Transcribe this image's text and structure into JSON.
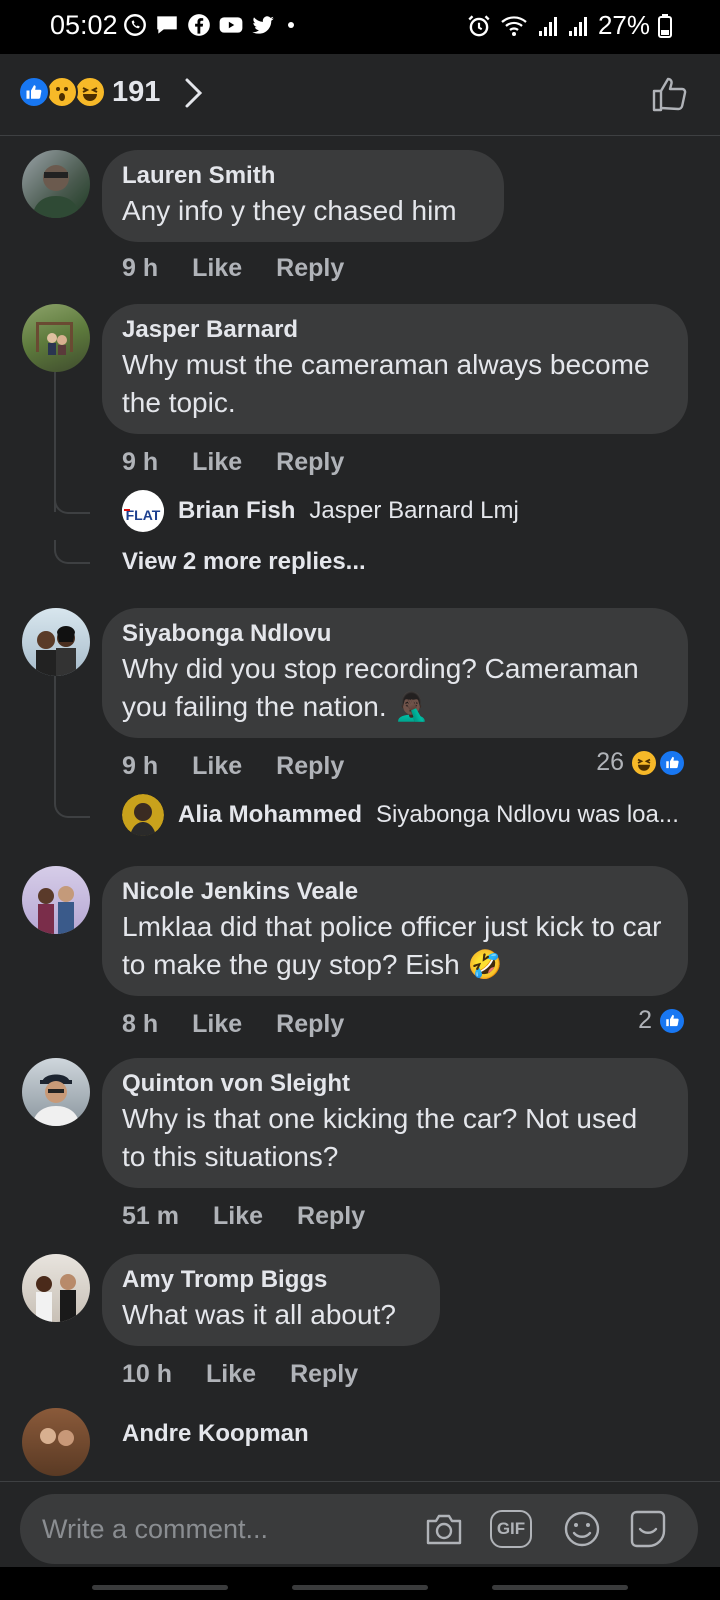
{
  "status_bar": {
    "time": "05:02",
    "battery": "27%",
    "left_icons": [
      "whatsapp-icon",
      "message-icon",
      "facebook-icon",
      "youtube-icon",
      "twitter-icon"
    ],
    "right_icons": [
      "alarm-icon",
      "wifi-icon",
      "signal-icon",
      "signal-icon",
      "battery-icon"
    ]
  },
  "header": {
    "reactions": [
      "like",
      "wow",
      "haha"
    ],
    "reaction_count": "191"
  },
  "comments": [
    {
      "name": "Lauren Smith",
      "text": "Any info y they chased him",
      "time": "9 h",
      "like": "Like",
      "reply": "Reply"
    },
    {
      "name": "Jasper Barnard",
      "text": "Why must the cameraman always become the topic.",
      "time": "9 h",
      "like": "Like",
      "reply": "Reply",
      "reply_preview": {
        "name": "Brian Fish",
        "text": "Jasper Barnard Lmj",
        "avatar_label": "FLAT"
      },
      "more_replies": "View 2 more replies..."
    },
    {
      "name": "Siyabonga Ndlovu",
      "text": "Why did you stop recording? Cameraman you failing the nation. 🤦🏿‍♂️",
      "time": "9 h",
      "like": "Like",
      "reply": "Reply",
      "reaction_count": "26",
      "reply_preview": {
        "name": "Alia Mohammed",
        "text": "Siyabonga Ndlovu was loa..."
      }
    },
    {
      "name": "Nicole Jenkins Veale",
      "text": "Lmklaa did that police officer just kick to car to make the guy stop? Eish 🤣",
      "time": "8 h",
      "like": "Like",
      "reply": "Reply",
      "reaction_count": "2"
    },
    {
      "name": "Quinton von Sleight",
      "text": "Why is that one kicking the car? Not used to this situations?",
      "time": "51 m",
      "like": "Like",
      "reply": "Reply"
    },
    {
      "name": "Amy Tromp Biggs",
      "text": "What was it all about?",
      "time": "10 h",
      "like": "Like",
      "reply": "Reply"
    },
    {
      "name": "Andre Koopman"
    }
  ],
  "composer": {
    "placeholder": "Write a comment...",
    "gif_label": "GIF"
  },
  "colors": {
    "background": "#242526",
    "bubble": "#3a3b3c",
    "text": "#e4e6eb",
    "secondary_text": "#b0b3b8",
    "like_blue": "#1877f2"
  }
}
